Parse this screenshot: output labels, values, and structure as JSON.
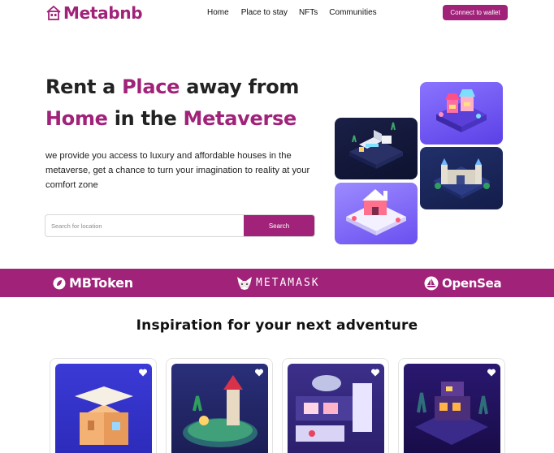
{
  "header": {
    "logo_text": "Metabnb",
    "nav": [
      "Home",
      "Place to stay",
      "NFTs",
      "Communities"
    ],
    "connect_label": "Connect to wallet"
  },
  "hero": {
    "title_part1": "Rent a ",
    "title_accent1": "Place",
    "title_part2": " away from ",
    "title_accent2": "Home",
    "title_part3": " in the ",
    "title_accent3": "Metaverse",
    "description": "we provide you access to luxury and affordable houses in the metaverse, get a chance to turn your imagination to reality at your comfort zone",
    "search_placeholder": "Search for location",
    "search_button": "Search"
  },
  "partners": [
    {
      "name": "MBToken",
      "icon": "mbtoken-icon"
    },
    {
      "name": "METAMASK",
      "icon": "metamask-fox-icon"
    },
    {
      "name": "OpenSea",
      "icon": "opensea-boat-icon"
    }
  ],
  "inspiration": {
    "title": "Inspiration for your next adventure"
  },
  "colors": {
    "brand": "#a02279",
    "text": "#222222",
    "white": "#ffffff"
  }
}
